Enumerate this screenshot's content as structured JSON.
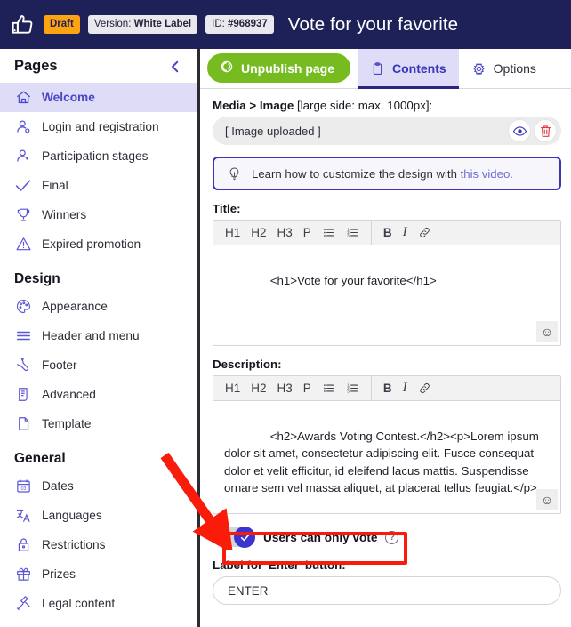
{
  "topbar": {
    "logo_icon": "thumbs-up-icon",
    "status_badge": "Draft",
    "version_prefix": "Version: ",
    "version_value": "White Label",
    "id_prefix": "ID: ",
    "id_value": "#968937",
    "page_title": "Vote for your favorite",
    "bg_color": "#1e2158",
    "draft_color": "#fca311"
  },
  "sidebar": {
    "header": "Pages",
    "collapse_icon": "chevron-left-icon",
    "pages": [
      {
        "label": "Welcome",
        "icon": "home-icon",
        "active": true
      },
      {
        "label": "Login and registration",
        "icon": "user-login-icon",
        "active": false
      },
      {
        "label": "Participation stages",
        "icon": "user-stages-icon",
        "active": false
      },
      {
        "label": "Final",
        "icon": "check-icon",
        "active": false
      },
      {
        "label": "Winners",
        "icon": "trophy-icon",
        "active": false
      },
      {
        "label": "Expired promotion",
        "icon": "warning-triangle-icon",
        "active": false
      }
    ],
    "design_header": "Design",
    "design": [
      {
        "label": "Appearance",
        "icon": "palette-icon"
      },
      {
        "label": "Header and menu",
        "icon": "menu-lines-icon"
      },
      {
        "label": "Footer",
        "icon": "footer-icon"
      },
      {
        "label": "Advanced",
        "icon": "document-code-icon"
      },
      {
        "label": "Template",
        "icon": "page-icon"
      }
    ],
    "general_header": "General",
    "general": [
      {
        "label": "Dates",
        "icon": "calendar-icon"
      },
      {
        "label": "Languages",
        "icon": "translate-icon"
      },
      {
        "label": "Restrictions",
        "icon": "lock-icon"
      },
      {
        "label": "Prizes",
        "icon": "gift-icon"
      },
      {
        "label": "Legal content",
        "icon": "gavel-icon"
      }
    ],
    "active_bg": "#dedcf7",
    "accent": "#4a45c9"
  },
  "tabs": {
    "unpublish_label": "Unpublish page",
    "unpublish_icon": "power-icon",
    "unpublish_color": "#76bc21",
    "items": [
      {
        "label": "Contents",
        "icon": "clipboard-icon",
        "active": true
      },
      {
        "label": "Options",
        "icon": "gear-icon",
        "active": false
      }
    ]
  },
  "content": {
    "media": {
      "label_bold": "Media > Image",
      "label_rest": " [large side: max. 1000px]:",
      "value": "[ Image uploaded ]",
      "preview_icon": "eye-icon",
      "delete_icon": "trash-icon",
      "preview_color": "#3a35b8",
      "delete_color": "#e03a3a"
    },
    "info": {
      "icon": "lightbulb-icon",
      "text": "Learn how to customize the design with ",
      "link": "this video.",
      "border_color": "#3a35b8"
    },
    "title_field": {
      "label": "Title:",
      "value": "<h1>Vote for your favorite</h1>"
    },
    "description_field": {
      "label": "Description:",
      "value": "<h2>Awards Voting Contest.</h2><p>Lorem ipsum dolor sit amet, consectetur adipiscing elit. Fusce consequat dolor et velit efficitur, id eleifend lacus mattis. Suspendisse ornare sem vel massa aliquet, at placerat tellus feugiat.</p>"
    },
    "editor_toolbar": {
      "buttons": [
        "H1",
        "H2",
        "H3",
        "P"
      ],
      "bullet_list_icon": "bullet-list-icon",
      "numbered_list_icon": "numbered-list-icon",
      "bold_label": "B",
      "italic_label": "I",
      "link_icon": "link-icon",
      "emoji_icon": "emoji-icon"
    },
    "toggle": {
      "label": "Users can only vote",
      "state": "on",
      "help_icon": "question-mark-icon",
      "knob_color": "#3a35cf"
    },
    "enter_field": {
      "label": "Label for 'Enter' button:",
      "value": "ENTER"
    }
  },
  "annotations": {
    "arrow_color": "#f91c0b",
    "highlight_color": "#f91c0b"
  }
}
